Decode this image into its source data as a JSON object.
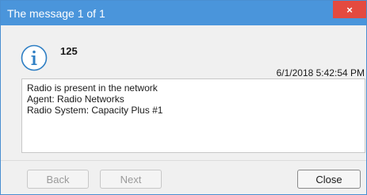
{
  "window": {
    "title": "The message 1 of 1",
    "close_glyph": "×"
  },
  "message": {
    "id": "125",
    "timestamp": "6/1/2018 5:42:54 PM",
    "lines": [
      "Radio is present in the network",
      "Agent: Radio Networks",
      "Radio System: Capacity Plus #1"
    ],
    "icon": "info-icon"
  },
  "buttons": {
    "back": "Back",
    "next": "Next",
    "close": "Close"
  },
  "colors": {
    "titlebar": "#4a95db",
    "close_button": "#e44a3f",
    "icon_accent": "#2f7fc4"
  }
}
